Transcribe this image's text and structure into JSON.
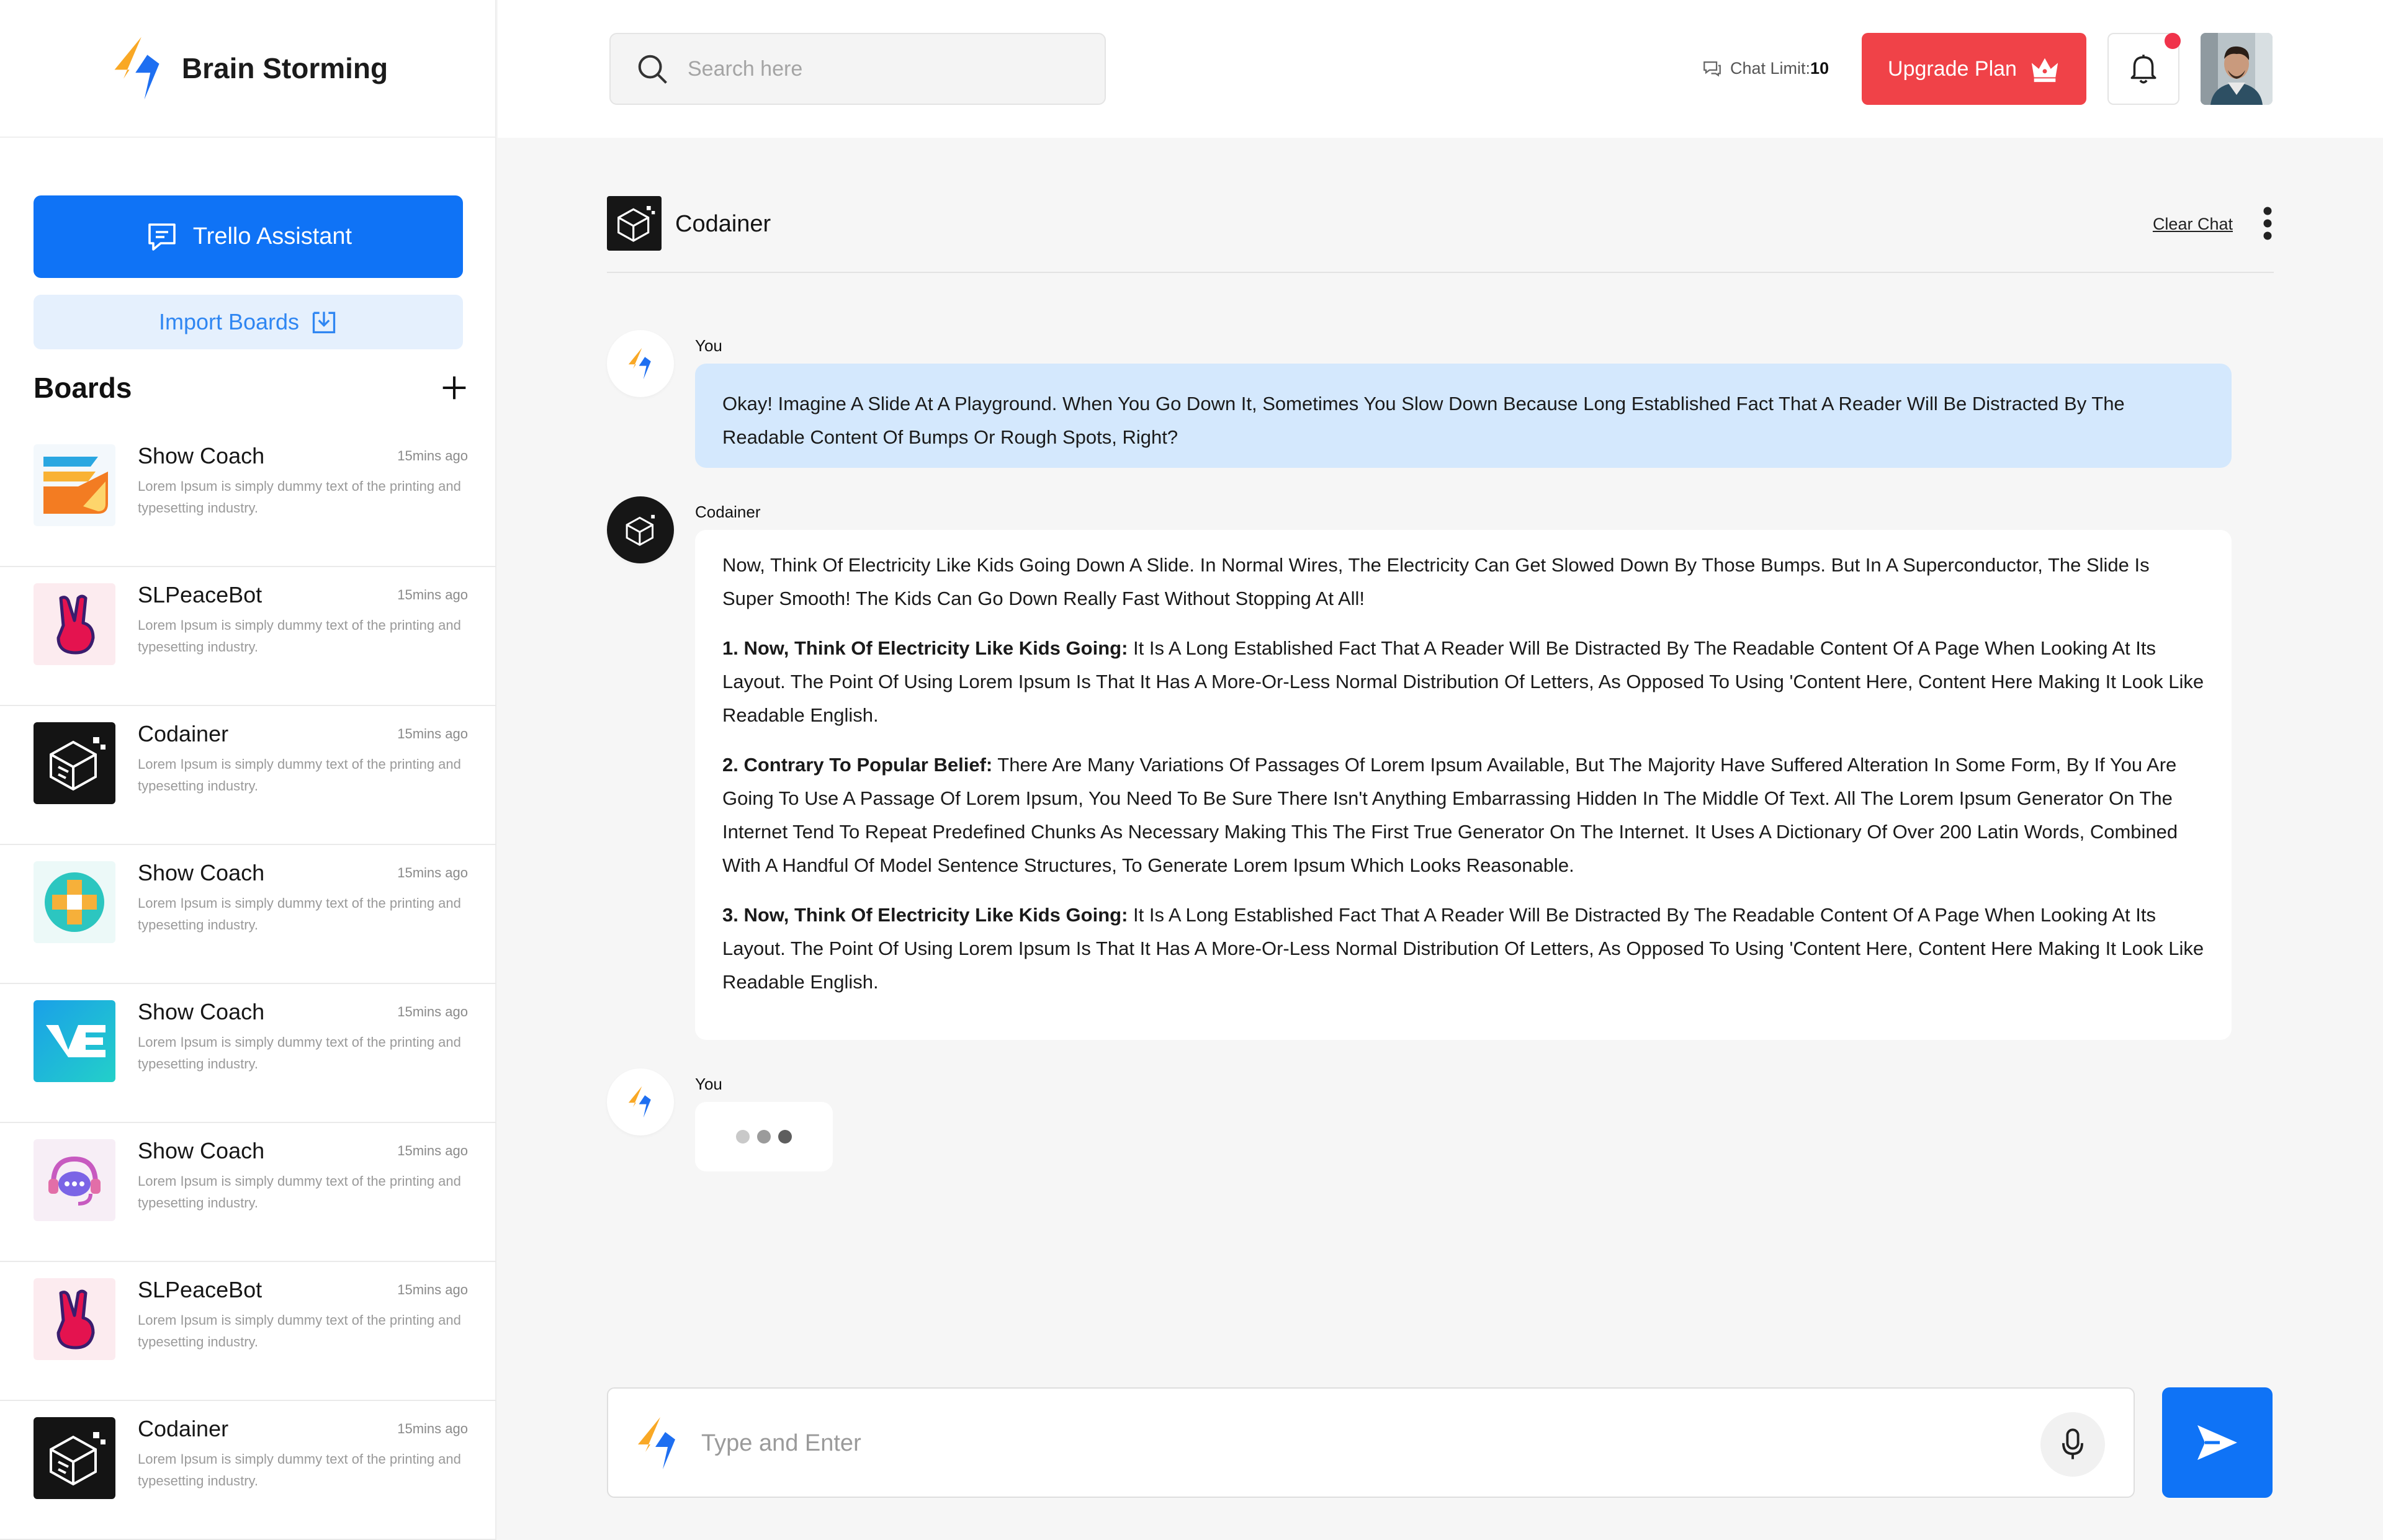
{
  "brand": {
    "name": "Brain Storming"
  },
  "sidebar": {
    "assistant_label": "Trello Assistant",
    "import_label": "Import Boards",
    "boards_title": "Boards",
    "boards": [
      {
        "name": "Show Coach",
        "time": "15mins ago",
        "desc": "Lorem Ipsum is simply dummy text of the printing and typesetting industry.",
        "thumb": "show-coach-orange"
      },
      {
        "name": "SLPeaceBot",
        "time": "15mins ago",
        "desc": "Lorem Ipsum is simply dummy text of the printing and typesetting industry.",
        "thumb": "peace-hand"
      },
      {
        "name": "Codainer",
        "time": "15mins ago",
        "desc": "Lorem Ipsum is simply dummy text of the printing and typesetting industry.",
        "thumb": "codainer-cube"
      },
      {
        "name": "Show Coach",
        "time": "15mins ago",
        "desc": "Lorem Ipsum is simply dummy text of the printing and typesetting industry.",
        "thumb": "cross-circle"
      },
      {
        "name": "Show Coach",
        "time": "15mins ago",
        "desc": "Lorem Ipsum is simply dummy text of the printing and typesetting industry.",
        "thumb": "ve-logo"
      },
      {
        "name": "Show Coach",
        "time": "15mins ago",
        "desc": "Lorem Ipsum is simply dummy text of the printing and typesetting industry.",
        "thumb": "chat-headset"
      },
      {
        "name": "SLPeaceBot",
        "time": "15mins ago",
        "desc": "Lorem Ipsum is simply dummy text of the printing and typesetting industry.",
        "thumb": "peace-hand"
      },
      {
        "name": "Codainer",
        "time": "15mins ago",
        "desc": "Lorem Ipsum is simply dummy text of the printing and typesetting industry.",
        "thumb": "codainer-cube"
      }
    ]
  },
  "header": {
    "search_placeholder": "Search here",
    "chat_limit_label": "Chat Limit:",
    "chat_limit_value": "10",
    "upgrade_label": "Upgrade Plan"
  },
  "chat": {
    "title": "Codainer",
    "clear_label": "Clear Chat",
    "user_author": "You",
    "bot_author": "Codainer",
    "user_message": "Okay! Imagine A Slide At A Playground. When You Go Down It, Sometimes You Slow Down Because Long Established Fact That A Reader Will Be Distracted By The Readable Content  Of Bumps Or Rough Spots, Right?",
    "bot_intro": "Now, Think Of Electricity Like Kids Going Down A Slide. In Normal Wires, The Electricity Can Get Slowed Down By Those Bumps. But In A Superconductor, The Slide Is Super Smooth! The Kids Can Go Down Really Fast Without Stopping At All!",
    "bot_points": [
      {
        "title": "1. Now, Think Of Electricity Like Kids Going:",
        "text": "It Is A Long Established Fact That A Reader Will Be Distracted By The Readable Content Of A Page When Looking At Its Layout. The Point Of Using Lorem Ipsum Is That It Has A More-Or-Less Normal Distribution Of Letters, As Opposed To Using 'Content Here, Content Here Making It Look Like Readable English."
      },
      {
        "title": "2. Contrary To Popular Belief:",
        "text": "There Are Many Variations Of Passages Of Lorem Ipsum Available, But The Majority Have Suffered Alteration In Some Form, By If You Are Going To Use A Passage Of Lorem Ipsum, You Need To Be Sure There Isn't Anything Embarrassing Hidden In The Middle Of Text. All The Lorem Ipsum Generator On The Internet Tend To Repeat Predefined Chunks As Necessary Making This The First True Generator On The Internet. It Uses A Dictionary Of Over 200 Latin Words, Combined With A Handful Of Model Sentence Structures, To Generate Lorem Ipsum Which Looks Reasonable."
      },
      {
        "title": "3. Now, Think Of Electricity Like Kids Going:",
        "text": "It Is A Long Established Fact That A Reader Will Be Distracted By The Readable Content Of A Page When Looking At Its Layout. The Point Of Using Lorem Ipsum Is That It Has A More-Or-Less Normal Distribution Of Letters, As Opposed To Using 'Content Here, Content Here Making It Look Like Readable English."
      }
    ],
    "typing_author": "You"
  },
  "composer": {
    "placeholder": "Type and Enter"
  },
  "colors": {
    "primary": "#0f73f6",
    "upgrade": "#f04248",
    "user_bubble": "#d4e8fd",
    "notification_dot": "#f0334b"
  }
}
